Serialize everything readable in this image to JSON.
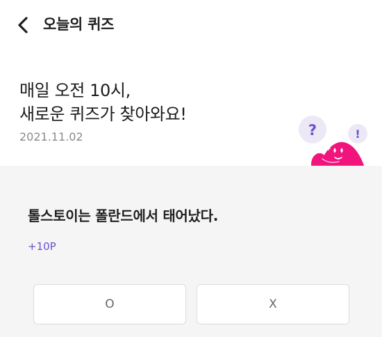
{
  "header": {
    "back_icon": "chevron-left-icon",
    "title": "오늘의 퀴즈"
  },
  "hero": {
    "line1": "매일 오전 10시,",
    "line2": "새로운 퀴즈가 찾아와요!",
    "date": "2021.11.02",
    "mascot": {
      "bubble_question": "?",
      "bubble_exclaim": "!",
      "body_color": "#f0147c",
      "bubble_color": "#ede8f6",
      "question_color": "#6b4fd1"
    }
  },
  "quiz": {
    "question": "톨스토이는 폴란드에서 태어났다.",
    "points": "+10P",
    "answers": {
      "o_label": "O",
      "x_label": "X"
    }
  },
  "colors": {
    "accent": "#6b4fd1",
    "panel_bg": "#f5f5f6",
    "mascot_pink": "#f0147c"
  }
}
